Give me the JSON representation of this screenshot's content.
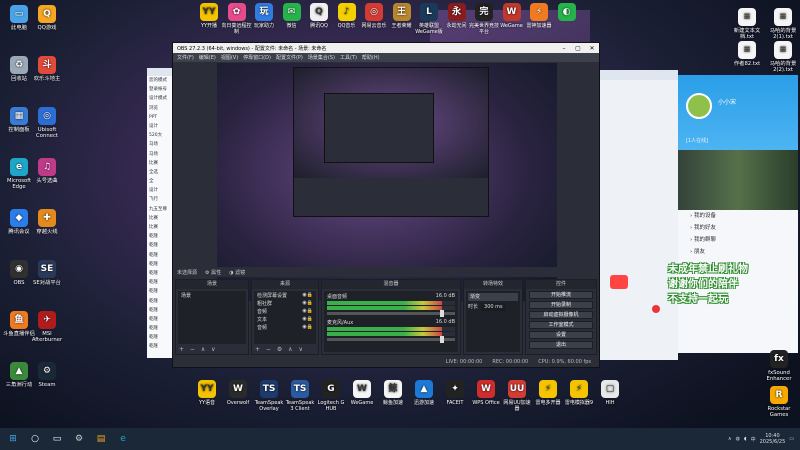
{
  "desktop": {
    "left_icons": [
      {
        "label": "此电脑",
        "icon": "computer-icon",
        "color": "#4aa3e8",
        "glyph": "▭"
      },
      {
        "label": "QQ游戏",
        "icon": "qq-game-icon",
        "color": "#f5a623",
        "glyph": "Q"
      },
      {
        "label": "回收站",
        "icon": "recycle-bin-icon",
        "color": "#9aa8b8",
        "glyph": "♻"
      },
      {
        "label": "欢乐斗地主",
        "icon": "doudizhu-icon",
        "color": "#e24a3b",
        "glyph": "斗"
      },
      {
        "label": "控制面板",
        "icon": "control-panel-icon",
        "color": "#3a7bd5",
        "glyph": "▦"
      },
      {
        "label": "Ubisoft Connect",
        "icon": "ubisoft-icon",
        "color": "#2b6fd6",
        "glyph": "◎"
      },
      {
        "label": "Microsoft Edge",
        "icon": "edge-icon",
        "color": "#1ea6c9",
        "glyph": "e"
      },
      {
        "label": "头号选曲",
        "icon": "music-icon",
        "color": "#c03a8a",
        "glyph": "♫"
      },
      {
        "label": "腾讯会议",
        "icon": "tencent-meeting-icon",
        "color": "#2b7de9",
        "glyph": "◆"
      },
      {
        "label": "穿越火线",
        "icon": "crossfire-icon",
        "color": "#e28b1c",
        "glyph": "✚"
      },
      {
        "label": "OBS",
        "icon": "obs-icon",
        "color": "#303030",
        "glyph": "◉"
      },
      {
        "label": "SE对战平台",
        "icon": "se-platform-icon",
        "color": "#2a3a5a",
        "glyph": "SE"
      },
      {
        "label": "斗鱼直播伴侣",
        "icon": "douyu-icon",
        "color": "#f07a20",
        "glyph": "鱼"
      },
      {
        "label": "MSI Afterburner",
        "icon": "msi-afterburner-icon",
        "color": "#b01c1c",
        "glyph": "✈"
      },
      {
        "label": "三角洲行动",
        "icon": "delta-force-icon",
        "color": "#3b8a3b",
        "glyph": "▲"
      },
      {
        "label": "Steam",
        "icon": "steam-icon",
        "color": "#1b2838",
        "glyph": "⚙"
      }
    ],
    "top_icons": [
      {
        "label": "YY开播",
        "icon": "yy-live-icon",
        "color": "#f5c400",
        "glyph": "YY"
      },
      {
        "label": "向日葵远程控制",
        "icon": "sunflower-icon",
        "color": "#e64b8c",
        "glyph": "✿"
      },
      {
        "label": "玩家助力",
        "icon": "player-assist-icon",
        "color": "#2f7de1",
        "glyph": "玩"
      },
      {
        "label": "微信",
        "icon": "wechat-icon",
        "color": "#27b34b",
        "glyph": "✉"
      },
      {
        "label": "腾讯QQ",
        "icon": "qq-icon",
        "color": "#f0f0f0",
        "glyph": "Q"
      },
      {
        "label": "QQ音乐",
        "icon": "qq-music-icon",
        "color": "#f5d000",
        "glyph": "♪"
      },
      {
        "label": "网易云音乐",
        "icon": "netease-music-icon",
        "color": "#d43c33",
        "glyph": "◎"
      },
      {
        "label": "王者荣耀",
        "icon": "honor-of-kings-icon",
        "color": "#b8862b",
        "glyph": "王"
      },
      {
        "label": "英雄联盟WeGame版",
        "icon": "lol-icon",
        "color": "#1a3a5a",
        "glyph": "L"
      },
      {
        "label": "永劫无间",
        "icon": "naraka-icon",
        "color": "#8a1c1c",
        "glyph": "永"
      },
      {
        "label": "完美世界竞技平台",
        "icon": "perfect-world-icon",
        "color": "#222",
        "glyph": "完"
      },
      {
        "label": "WeGame",
        "icon": "wegame-icon",
        "color": "#c0392b",
        "glyph": "W"
      },
      {
        "label": "雷神加速器",
        "icon": "leishen-icon",
        "color": "#f07a20",
        "glyph": "⚡"
      },
      {
        "label": "",
        "icon": "green-app-icon",
        "color": "#27b34b",
        "glyph": "◐"
      }
    ],
    "right_icons": [
      {
        "label": "新建文本文档.txt",
        "icon": "text-file-icon",
        "color": "#f5f5f5",
        "glyph": "≡"
      },
      {
        "label": "马哈的背景2(1).txt",
        "icon": "text-file-icon",
        "color": "#f5f5f5",
        "glyph": "≡"
      },
      {
        "label": "作者82.txt",
        "icon": "text-file-icon",
        "color": "#f5f5f5",
        "glyph": "≡"
      },
      {
        "label": "马哈的背景2(2).txt",
        "icon": "text-file-icon",
        "color": "#f5f5f5",
        "glyph": "≡"
      }
    ],
    "right_bottom_icons": [
      {
        "label": "fxSound Enhancer",
        "icon": "fxsound-icon",
        "color": "#222",
        "glyph": "fx"
      },
      {
        "label": "Rockstar Games",
        "icon": "rockstar-icon",
        "color": "#f5a800",
        "glyph": "R"
      }
    ],
    "bottom_icons": [
      {
        "label": "YY语音",
        "icon": "yy-voice-icon",
        "color": "#f5c400",
        "glyph": "YY"
      },
      {
        "label": "Overwolf",
        "icon": "overwolf-icon",
        "color": "#2a2a2a",
        "glyph": "W"
      },
      {
        "label": "TeamSpeak Overlay",
        "icon": "teamspeak-overlay-icon",
        "color": "#1d3a6a",
        "glyph": "TS"
      },
      {
        "label": "TeamSpeak 3 Client",
        "icon": "teamspeak-icon",
        "color": "#2a5aa0",
        "glyph": "TS"
      },
      {
        "label": "Logitech G HUB",
        "icon": "logitech-icon",
        "color": "#222",
        "glyph": "G"
      },
      {
        "label": "WeGame",
        "icon": "wegame-icon",
        "color": "#f5f5f5",
        "glyph": "W"
      },
      {
        "label": "鲸鱼加速",
        "icon": "whale-icon",
        "color": "#f5f5f5",
        "glyph": "鲸"
      },
      {
        "label": "迅游加速",
        "icon": "xunyou-icon",
        "color": "#1c7ad6",
        "glyph": "▲"
      },
      {
        "label": "FACEIT",
        "icon": "faceit-icon",
        "color": "#222",
        "glyph": "✦"
      },
      {
        "label": "WPS Office",
        "icon": "wps-icon",
        "color": "#d12c2c",
        "glyph": "W"
      },
      {
        "label": "网易UU加速器",
        "icon": "uu-icon",
        "color": "#d43c33",
        "glyph": "UU"
      },
      {
        "label": "雷电多开器",
        "icon": "ldmulti-icon",
        "color": "#f5c400",
        "glyph": "⚡"
      },
      {
        "label": "雷电模拟器9",
        "icon": "ldplayer-icon",
        "color": "#f5c400",
        "glyph": "⚡"
      },
      {
        "label": "HIH",
        "icon": "file-icon",
        "color": "#e8e8e8",
        "glyph": "▢"
      }
    ]
  },
  "obs": {
    "title": "OBS 27.2.3 (64-bit, windows) - 配置文件: 未命名 - 场景: 未命名",
    "menu": [
      "文件(F)",
      "编辑(E)",
      "视图(V)",
      "停靠窗口(D)",
      "配置文件(P)",
      "场景集合(S)",
      "工具(T)",
      "帮助(H)"
    ],
    "scenebar": {
      "label": "未选择源",
      "props": "属性",
      "filters": "滤镜"
    },
    "docks": {
      "scenes": {
        "title": "场景",
        "items": [
          "场景"
        ]
      },
      "sources": {
        "title": "来源",
        "items": [
          "检测屏幕设置",
          "粗社群",
          "音频",
          "文本",
          "音频"
        ]
      },
      "mixer": {
        "title": "混音器",
        "channels": [
          {
            "name": "桌面音频",
            "db": "16.0 dB"
          },
          {
            "name": "麦克风/Aux",
            "db": "16.0 dB"
          }
        ]
      },
      "transitions": {
        "title": "转场特效",
        "type": "渐变",
        "duration_label": "时长",
        "duration": "300 ms"
      },
      "controls": {
        "title": "控件",
        "buttons": [
          "开始推流",
          "开始录制",
          "启动虚拟摄像机",
          "工作室模式",
          "设置",
          "退出"
        ]
      }
    },
    "status": {
      "live": "LIVE: 00:00:00",
      "rec": "REC: 00:00:00",
      "cpu": "CPU: 0.9%, 60.00 fps"
    }
  },
  "browser_left": {
    "items": [
      "您的模式",
      "登录帐号",
      "设计模式",
      "浏览",
      "PPT",
      "设计",
      "520大",
      "马场",
      "马场",
      "比赛",
      "全选",
      "全",
      "设计",
      "飞行",
      "九五至尊",
      "比赛",
      "比赛",
      "乾隆",
      "乾隆",
      "乾隆",
      "乾隆",
      "乾隆",
      "乾隆",
      "乾隆",
      "乾隆",
      "乾隆",
      "乾隆",
      "乾隆",
      "乾隆",
      "乾隆"
    ]
  },
  "qq": {
    "name": "小小宋",
    "status": "[1人在线]",
    "sections": [
      "我的设备",
      "我的好友",
      "我的群聊",
      "朋友"
    ]
  },
  "sticker": {
    "lines": [
      "未成年禁止刷礼物",
      "谢谢你们的陪伴",
      "不支持一起玩"
    ]
  },
  "taskbar": {
    "clock_time": "10:40",
    "clock_date": "2025/6/25",
    "lang": "中"
  }
}
